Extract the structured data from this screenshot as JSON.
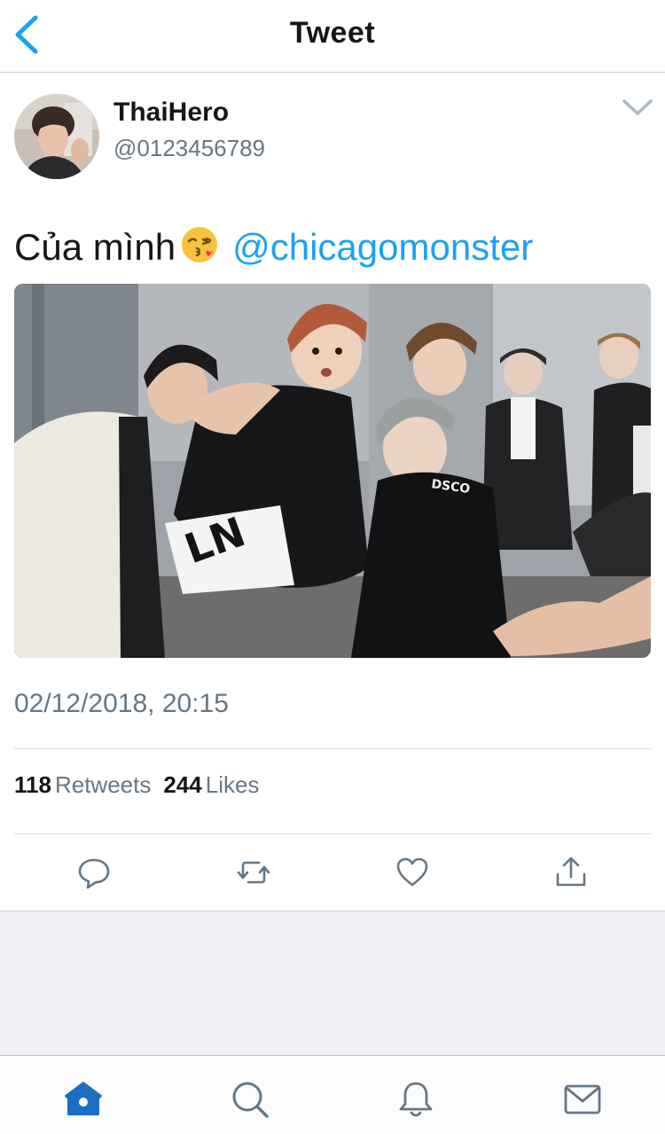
{
  "nav": {
    "title": "Tweet",
    "back_icon": "chevron-left-icon"
  },
  "author": {
    "display_name": "ThaiHero",
    "handle": "@0123456789"
  },
  "tweet": {
    "text": "Của mình",
    "emoji": "face-throwing-kiss-emoji",
    "mention": "@chicagomonster",
    "timestamp": "02/12/2018, 20:15"
  },
  "stats": {
    "retweets_count": "118",
    "retweets_label": "Retweets",
    "likes_count": "244",
    "likes_label": "Likes"
  },
  "actions": [
    "reply-icon",
    "retweet-icon",
    "like-icon",
    "share-icon"
  ],
  "tabs": [
    "home-icon",
    "search-icon",
    "notifications-icon",
    "messages-icon"
  ],
  "colors": {
    "accent": "#1da1f2",
    "tab_active": "#1b6fc2",
    "secondary_text": "#657786",
    "icon_gray": "#657786"
  }
}
